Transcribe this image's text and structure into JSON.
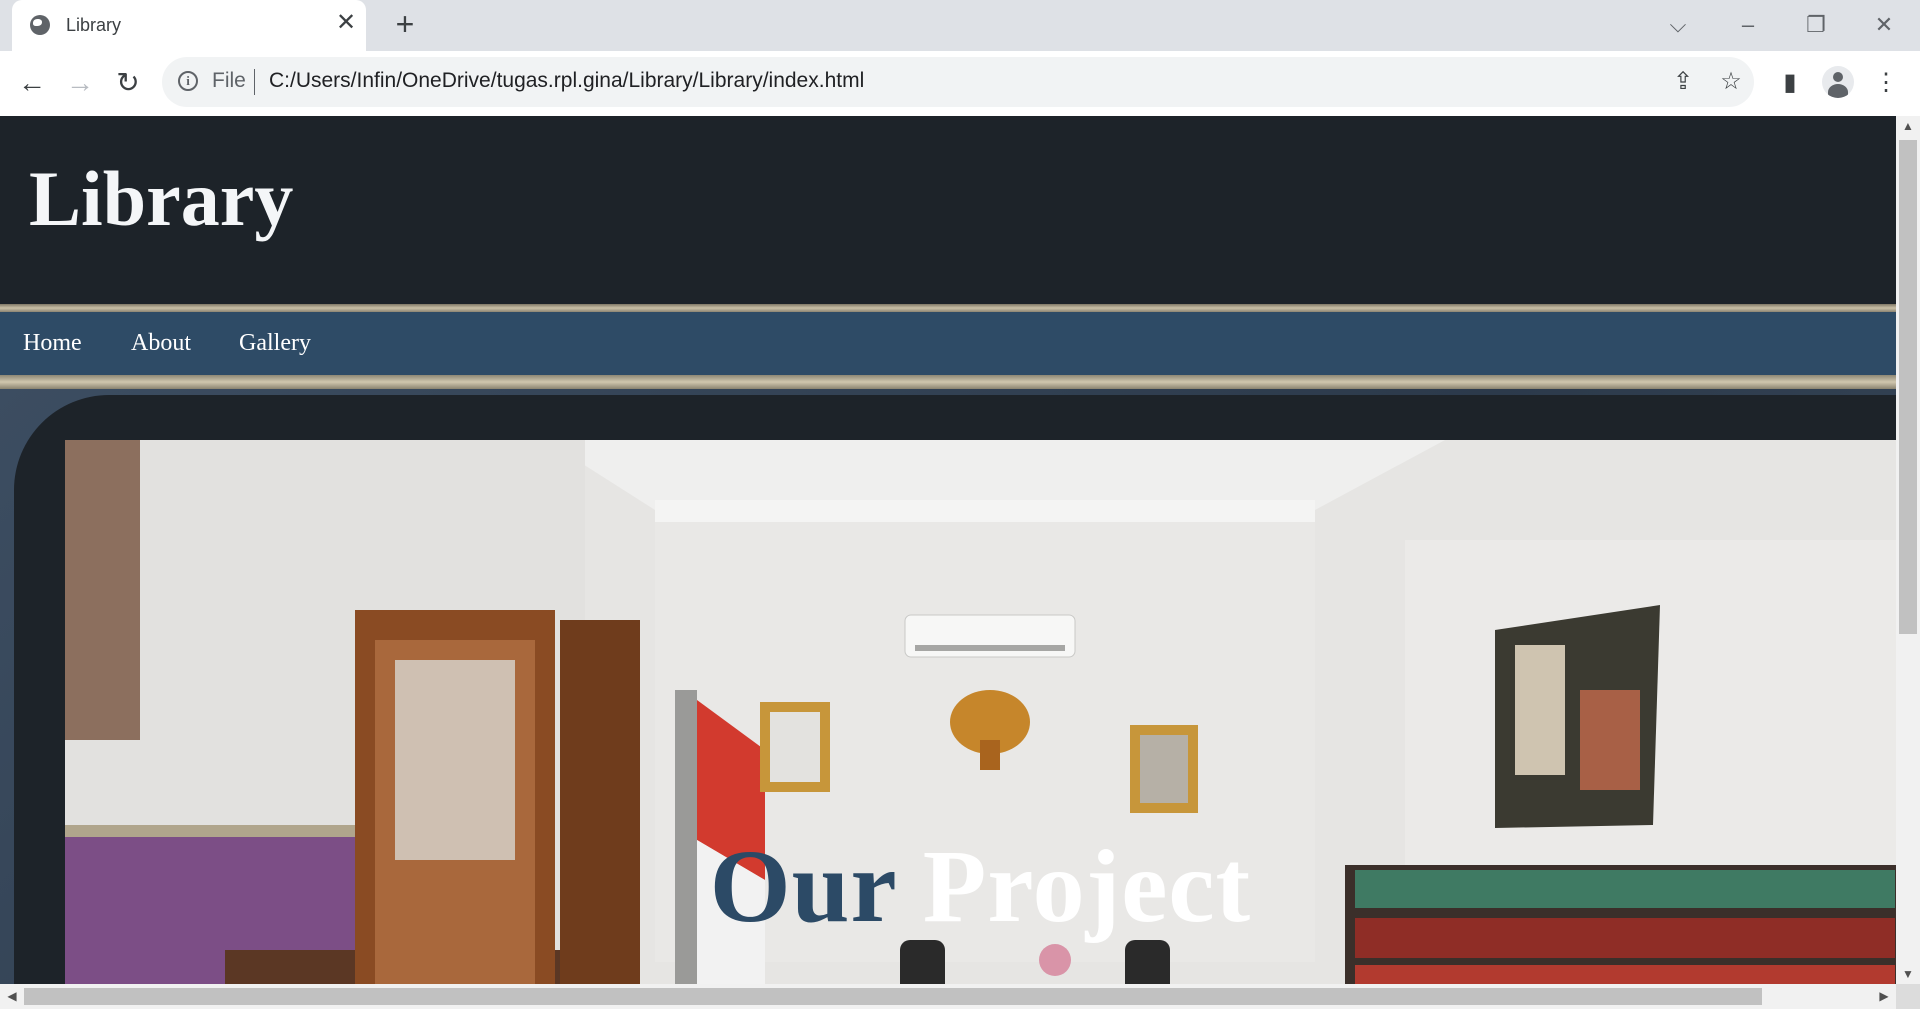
{
  "browser": {
    "tab_title": "Library",
    "tab_close_icon": "✕",
    "new_tab_icon": "+",
    "window_controls": {
      "tab_search": "⌵",
      "minimize": "–",
      "restore": "❐",
      "close": "✕"
    },
    "nav": {
      "back": "←",
      "forward": "→",
      "reload": "↻"
    },
    "omnibox": {
      "info_icon": "i",
      "scheme_label": "File",
      "url": "C:/Users/Infin/OneDrive/tugas.rpl.gina/Library/Library/index.html",
      "share_icon": "⇪",
      "star_icon": "☆"
    },
    "toolbar_icons": {
      "side_panel": "▮",
      "menu": "⋮"
    }
  },
  "site": {
    "title": "Library",
    "nav_items": [
      "Home",
      "About",
      "Gallery"
    ],
    "hero": {
      "heading_word1": "Our",
      "heading_word2": "Project"
    }
  },
  "scrollbars": {
    "up": "▲",
    "down": "▼",
    "left": "◀",
    "right": "▶"
  },
  "colors": {
    "header_bg": "#1d2329",
    "nav_bg": "#2e4b66",
    "accent_heading": "#2c4a66"
  }
}
